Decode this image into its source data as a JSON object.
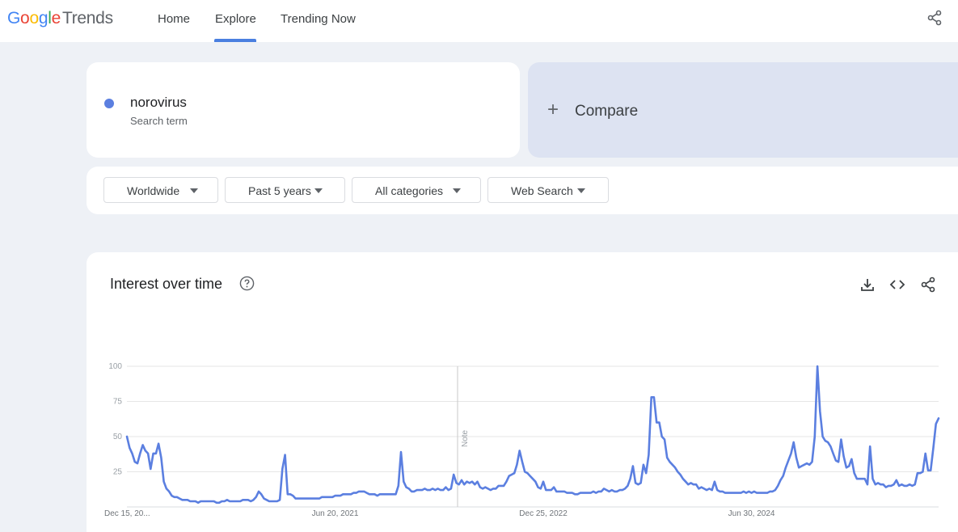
{
  "nav": {
    "logo_word": "Google",
    "logo_product": "Trends",
    "items": [
      "Home",
      "Explore",
      "Trending Now"
    ],
    "active": "Explore"
  },
  "search": {
    "term": "norovirus",
    "term_type": "Search term",
    "term_color": "#5b7fe0",
    "compare_label": "Compare"
  },
  "filters": {
    "region": "Worldwide",
    "time": "Past 5 years",
    "category": "All categories",
    "property": "Web Search"
  },
  "chart_section": {
    "title": "Interest over time",
    "icons": [
      "help-icon",
      "download-icon",
      "embed-icon",
      "share-icon"
    ]
  },
  "chart_data": {
    "type": "line",
    "x_start": "2019-12-15",
    "x_step_days": 7,
    "x_tick_labels": [
      "Dec 15, 20...",
      "Jun 20, 2021",
      "Dec 25, 2022",
      "Jun 30, 2024"
    ],
    "ylim": [
      0,
      100
    ],
    "y_ticks": [
      25,
      50,
      75,
      100
    ],
    "grid": true,
    "note_label": "Note",
    "series": [
      {
        "color": "#5b7fe0",
        "values": [
          50,
          42,
          38,
          32,
          31,
          38,
          44,
          40,
          38,
          27,
          38,
          38,
          45,
          35,
          18,
          13,
          11,
          8,
          7,
          7,
          6,
          5,
          5,
          5,
          4,
          4,
          4,
          3,
          4,
          4,
          4,
          4,
          4,
          4,
          3,
          3,
          4,
          4,
          5,
          4,
          4,
          4,
          4,
          4,
          5,
          5,
          5,
          4,
          5,
          7,
          11,
          9,
          6,
          5,
          4,
          4,
          4,
          4,
          5,
          27,
          37,
          9,
          9,
          8,
          6,
          6,
          6,
          6,
          6,
          6,
          6,
          6,
          6,
          6,
          7,
          7,
          7,
          7,
          7,
          8,
          8,
          8,
          9,
          9,
          9,
          9,
          10,
          10,
          11,
          11,
          11,
          10,
          9,
          9,
          9,
          8,
          9,
          9,
          9,
          9,
          9,
          9,
          9,
          15,
          39,
          18,
          14,
          13,
          11,
          11,
          12,
          12,
          12,
          13,
          12,
          12,
          13,
          12,
          13,
          12,
          12,
          14,
          12,
          13,
          23,
          17,
          16,
          19,
          16,
          18,
          17,
          18,
          16,
          18,
          14,
          13,
          14,
          13,
          12,
          13,
          13,
          15,
          15,
          15,
          18,
          22,
          23,
          24,
          30,
          40,
          32,
          25,
          24,
          22,
          20,
          18,
          14,
          13,
          18,
          12,
          12,
          12,
          14,
          11,
          11,
          11,
          11,
          10,
          10,
          10,
          9,
          9,
          10,
          10,
          10,
          10,
          10,
          11,
          10,
          11,
          11,
          13,
          12,
          11,
          12,
          11,
          11,
          12,
          12,
          13,
          15,
          20,
          29,
          17,
          16,
          17,
          30,
          24,
          37,
          78,
          78,
          60,
          60,
          50,
          48,
          35,
          32,
          30,
          28,
          25,
          23,
          20,
          18,
          16,
          17,
          16,
          16,
          13,
          14,
          13,
          12,
          13,
          12,
          18,
          12,
          11,
          11,
          10,
          10,
          10,
          10,
          10,
          10,
          10,
          11,
          10,
          11,
          10,
          11,
          10,
          10,
          10,
          10,
          10,
          11,
          11,
          12,
          15,
          19,
          22,
          28,
          33,
          38,
          46,
          35,
          28,
          29,
          30,
          31,
          30,
          32,
          50,
          100,
          68,
          50,
          47,
          46,
          43,
          38,
          33,
          32,
          48,
          36,
          28,
          29,
          34,
          24,
          20,
          20,
          20,
          20,
          16,
          43,
          20,
          16,
          17,
          16,
          16,
          14,
          15,
          15,
          16,
          19,
          15,
          16,
          15,
          15,
          16,
          15,
          16,
          24,
          24,
          25,
          38,
          26,
          26,
          42,
          59,
          63
        ]
      }
    ]
  }
}
